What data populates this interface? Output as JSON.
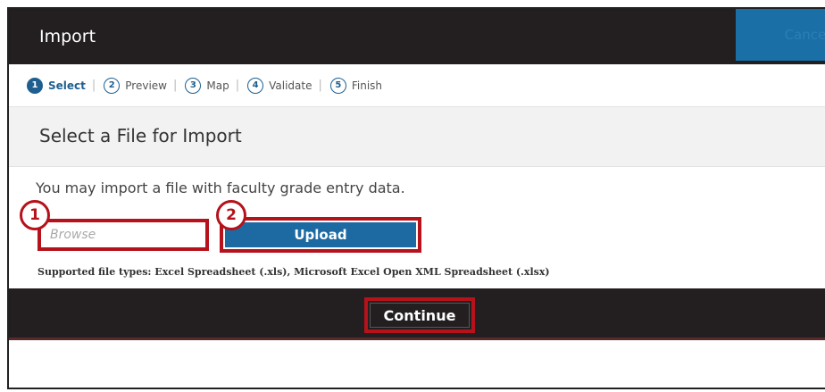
{
  "dialog": {
    "title": "Import",
    "cancel_label": "Cancel"
  },
  "steps": [
    {
      "num": "1",
      "label": "Select"
    },
    {
      "num": "2",
      "label": "Preview"
    },
    {
      "num": "3",
      "label": "Map"
    },
    {
      "num": "4",
      "label": "Validate"
    },
    {
      "num": "5",
      "label": "Finish"
    }
  ],
  "separator": "|",
  "section": {
    "title": "Select a File for Import"
  },
  "content": {
    "intro": "You may import a file with faculty grade entry data.",
    "browse_placeholder": "Browse",
    "upload_label": "Upload",
    "supported": "Supported file types: Excel Spreadsheet (.xls), Microsoft Excel Open XML Spreadsheet (.xlsx)"
  },
  "callouts": {
    "one": "1",
    "two": "2"
  },
  "footer": {
    "continue_label": "Continue"
  },
  "colors": {
    "highlight": "#b5121b",
    "primary": "#1d6aa3",
    "dark": "#231f20"
  }
}
